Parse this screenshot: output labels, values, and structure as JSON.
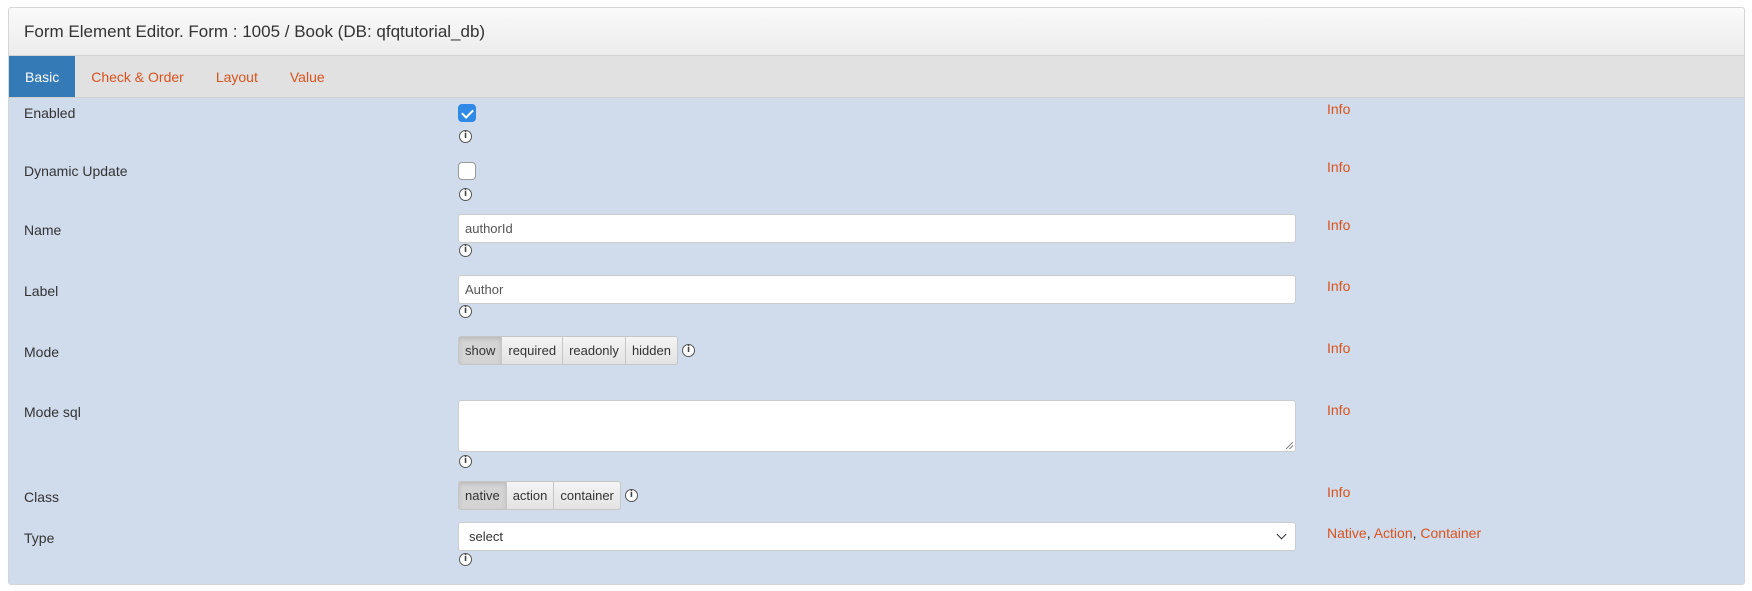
{
  "header": {
    "title": "Form Element Editor. Form : 1005 / Book (DB: qfqtutorial_db)"
  },
  "tabs": [
    {
      "label": "Basic",
      "active": true
    },
    {
      "label": "Check & Order"
    },
    {
      "label": "Layout"
    },
    {
      "label": "Value"
    }
  ],
  "info_label": "Info",
  "fields": {
    "enabled": {
      "label": "Enabled",
      "checked": true
    },
    "dynamic_update": {
      "label": "Dynamic Update",
      "checked": false
    },
    "name": {
      "label": "Name",
      "value": "authorId"
    },
    "label": {
      "label": "Label",
      "value": "Author"
    },
    "mode": {
      "label": "Mode",
      "options": [
        "show",
        "required",
        "readonly",
        "hidden"
      ],
      "selected": "show"
    },
    "mode_sql": {
      "label": "Mode sql",
      "value": ""
    },
    "class": {
      "label": "Class",
      "options": [
        "native",
        "action",
        "container"
      ],
      "selected": "native"
    },
    "type": {
      "label": "Type",
      "value": "select",
      "links": [
        "Native",
        "Action",
        "Container"
      ]
    }
  },
  "icons": {
    "info": "info-icon",
    "check": "check-icon",
    "dropdown": "chevron-down-icon"
  },
  "colors": {
    "accent": "#d9531e",
    "tab_active": "#337ab7",
    "panel_bg": "#d0dcec",
    "checkbox": "#2e8ae6"
  }
}
